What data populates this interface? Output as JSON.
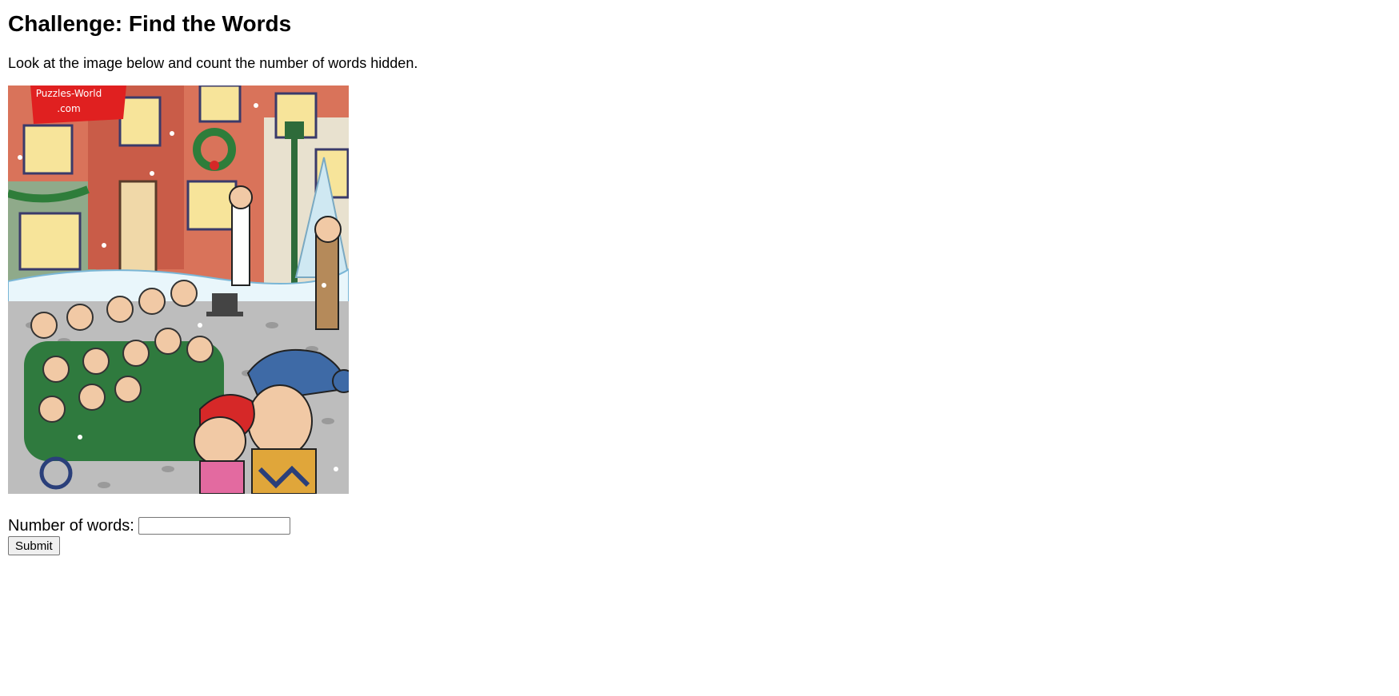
{
  "page": {
    "title": "Challenge: Find the Words",
    "instructions": "Look at the image below and count the number of words hidden."
  },
  "image": {
    "logo_line1": "Puzzles-World",
    "logo_line2": ".com"
  },
  "form": {
    "label": "Number of words:",
    "input_value": "",
    "submit_label": "Submit"
  }
}
